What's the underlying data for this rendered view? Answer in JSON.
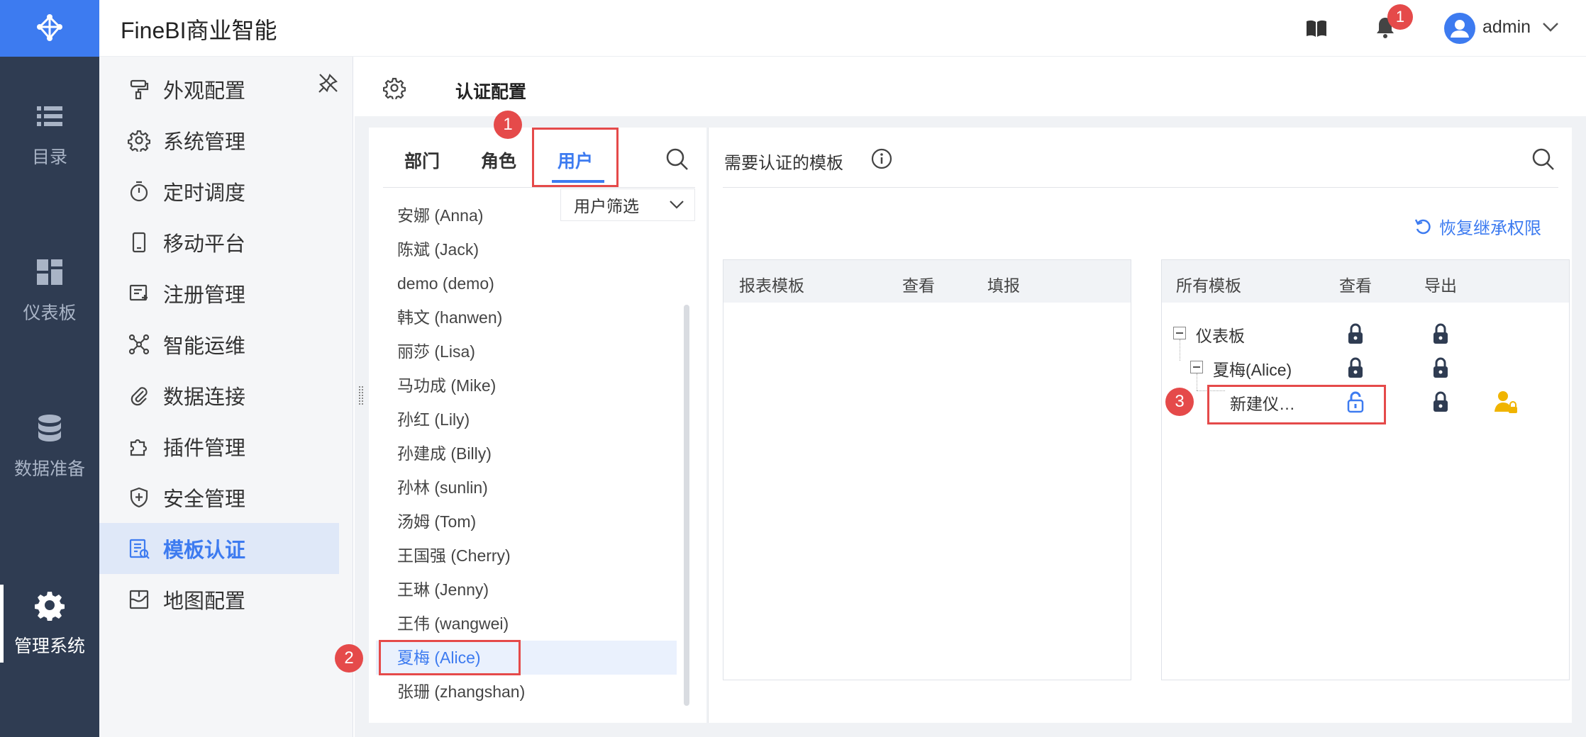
{
  "app": {
    "title": "FineBI商业智能"
  },
  "header": {
    "user": "admin",
    "notification_count": "1"
  },
  "rail": {
    "items": [
      {
        "label": "目录",
        "icon": "list-icon"
      },
      {
        "label": "仪表板",
        "icon": "dashboard-icon"
      },
      {
        "label": "数据准备",
        "icon": "database-icon"
      },
      {
        "label": "管理系统",
        "icon": "gear-icon"
      }
    ]
  },
  "sidemenu": {
    "items": [
      {
        "label": "外观配置",
        "icon": "paint-roller-icon"
      },
      {
        "label": "系统管理",
        "icon": "gear-icon"
      },
      {
        "label": "定时调度",
        "icon": "timer-icon"
      },
      {
        "label": "移动平台",
        "icon": "mobile-icon"
      },
      {
        "label": "注册管理",
        "icon": "register-icon"
      },
      {
        "label": "智能运维",
        "icon": "network-icon"
      },
      {
        "label": "数据连接",
        "icon": "paperclip-icon"
      },
      {
        "label": "插件管理",
        "icon": "puzzle-icon"
      },
      {
        "label": "安全管理",
        "icon": "shield-icon"
      },
      {
        "label": "模板认证",
        "icon": "template-auth-icon"
      },
      {
        "label": "地图配置",
        "icon": "map-icon"
      }
    ],
    "active": "模板认证"
  },
  "breadcrumb": {
    "title": "认证配置"
  },
  "tabs": [
    "部门",
    "角色",
    "用户"
  ],
  "active_tab": "用户",
  "filter": {
    "label": "用户筛选"
  },
  "users": [
    "安娜 (Anna)",
    "陈斌 (Jack)",
    "demo (demo)",
    "韩文 (hanwen)",
    "丽莎 (Lisa)",
    "马功成 (Mike)",
    "孙红 (Lily)",
    "孙建成 (Billy)",
    "孙林 (sunlin)",
    "汤姆 (Tom)",
    "王国强 (Cherry)",
    "王琳 (Jenny)",
    "王伟 (wangwei)",
    "夏梅 (Alice)",
    "张珊 (zhangshan)"
  ],
  "selected_user": "夏梅 (Alice)",
  "right": {
    "title": "需要认证的模板",
    "restore": "恢复继承权限",
    "report_grid": {
      "headers": [
        "报表模板",
        "查看",
        "填报"
      ]
    },
    "all_grid": {
      "headers": [
        "所有模板",
        "查看",
        "导出"
      ],
      "tree": [
        {
          "label": "仪表板",
          "level": 0
        },
        {
          "label": "夏梅(Alice)",
          "level": 1
        },
        {
          "label": "新建仪…",
          "level": 2
        }
      ]
    }
  },
  "annotations": [
    "1",
    "2",
    "3"
  ],
  "colors": {
    "accent": "#3d7bf0",
    "rail": "#2f3c52",
    "highlight": "#e54a4a"
  }
}
